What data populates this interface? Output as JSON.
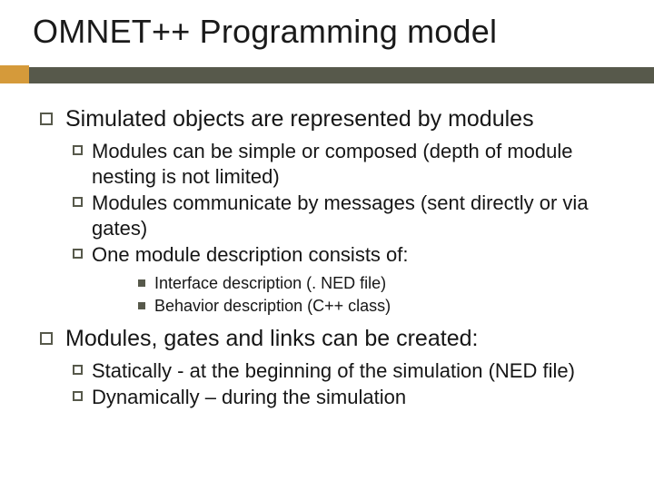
{
  "title": "OMNET++ Programming model",
  "points": [
    {
      "text": "Simulated objects are represented by modules",
      "sub": [
        {
          "text": "Modules can be simple or composed (depth of module nesting is not limited)"
        },
        {
          "text": "Modules communicate by messages (sent directly or via gates)"
        },
        {
          "text": "One module description consists of:",
          "sub": [
            {
              "text": "Interface description (. NED file)"
            },
            {
              "text": "Behavior description (C++ class)"
            }
          ]
        }
      ]
    },
    {
      "text": "Modules, gates and links can be created:",
      "sub": [
        {
          "text": "Statically - at the beginning of the simulation (NED file)"
        },
        {
          "text": "Dynamically – during the simulation"
        }
      ]
    }
  ]
}
